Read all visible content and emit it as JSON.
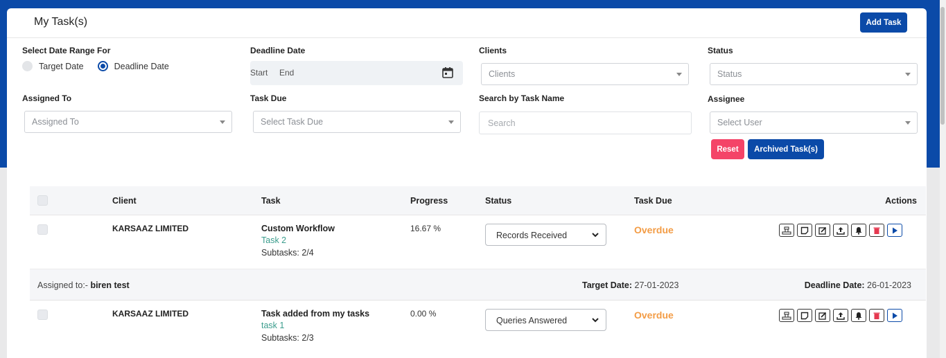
{
  "header": {
    "title": "My Task(s)",
    "add_task_label": "Add Task"
  },
  "filters": {
    "date_range_label": "Select Date Range For",
    "radio_target": "Target Date",
    "radio_deadline": "Deadline Date",
    "deadline_label": "Deadline Date",
    "start_label": "Start",
    "end_label": "End",
    "clients_label": "Clients",
    "clients_placeholder": "Clients",
    "status_label": "Status",
    "status_placeholder": "Status",
    "assigned_to_label": "Assigned To",
    "assigned_to_placeholder": "Assigned To",
    "task_due_label": "Task Due",
    "task_due_placeholder": "Select Task Due",
    "search_label": "Search by Task Name",
    "search_placeholder": "Search",
    "assignee_label": "Assignee",
    "assignee_placeholder": "Select User",
    "reset_label": "Reset",
    "archived_label": "Archived Task(s)"
  },
  "table": {
    "columns": {
      "client": "Client",
      "task": "Task",
      "progress": "Progress",
      "status": "Status",
      "task_due": "Task Due",
      "actions": "Actions"
    },
    "rows": [
      {
        "client": "KARSAAZ LIMITED",
        "task": "Custom Workflow",
        "task_link": "Task 2",
        "subtasks": "Subtasks: 2/4",
        "progress": "16.67 %",
        "status": "Records Received",
        "due": "Overdue"
      },
      {
        "client": "KARSAAZ LIMITED",
        "task": "Task added from my tasks",
        "task_link": "task 1",
        "subtasks": "Subtasks: 2/3",
        "progress": "0.00 %",
        "status": "Queries Answered",
        "due": "Overdue"
      }
    ],
    "assigned": {
      "assigned_prefix": "Assigned to:- ",
      "assigned_name": "biren test",
      "target_label": "Target Date:",
      "target_value": " 27-01-2023",
      "deadline_label": "Deadline Date:",
      "deadline_value": " 26-01-2023"
    }
  },
  "colors": {
    "brand": "#0b4aa8",
    "danger": "#f44468",
    "overdue": "#f39c45",
    "link": "#3a9c8c"
  }
}
